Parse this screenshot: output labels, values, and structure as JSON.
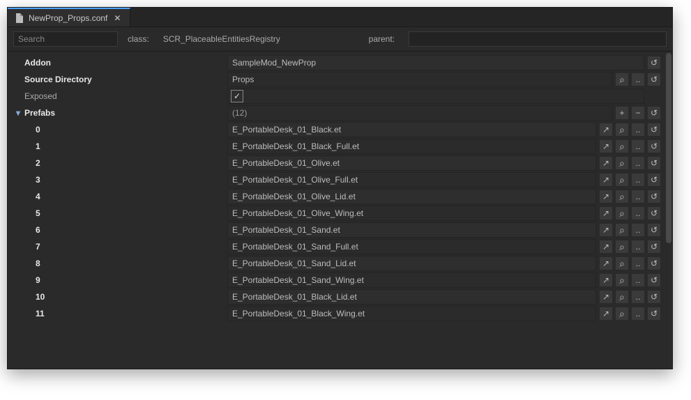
{
  "tab": {
    "title": "NewProp_Props.conf"
  },
  "toolbar": {
    "search_placeholder": "Search",
    "class_label": "class:",
    "class_value": "SCR_PlaceableEntitiesRegistry",
    "parent_label": "parent:"
  },
  "props": {
    "addon": {
      "label": "Addon",
      "value": "SampleMod_NewProp"
    },
    "source_dir": {
      "label": "Source Directory",
      "value": "Props"
    },
    "exposed": {
      "label": "Exposed",
      "checked": true
    },
    "prefabs": {
      "label": "Prefabs",
      "count_display": "(12)",
      "items": [
        {
          "index": "0",
          "value": "E_PortableDesk_01_Black.et"
        },
        {
          "index": "1",
          "value": "E_PortableDesk_01_Black_Full.et"
        },
        {
          "index": "2",
          "value": "E_PortableDesk_01_Olive.et"
        },
        {
          "index": "3",
          "value": "E_PortableDesk_01_Olive_Full.et"
        },
        {
          "index": "4",
          "value": "E_PortableDesk_01_Olive_Lid.et"
        },
        {
          "index": "5",
          "value": "E_PortableDesk_01_Olive_Wing.et"
        },
        {
          "index": "6",
          "value": "E_PortableDesk_01_Sand.et"
        },
        {
          "index": "7",
          "value": "E_PortableDesk_01_Sand_Full.et"
        },
        {
          "index": "8",
          "value": "E_PortableDesk_01_Sand_Lid.et"
        },
        {
          "index": "9",
          "value": "E_PortableDesk_01_Sand_Wing.et"
        },
        {
          "index": "10",
          "value": "E_PortableDesk_01_Black_Lid.et"
        },
        {
          "index": "11",
          "value": "E_PortableDesk_01_Black_Wing.et"
        }
      ]
    }
  },
  "icons": {
    "plus": "+",
    "minus": "−",
    "dots": "..",
    "reset": "↺",
    "open": "↗",
    "search": "⌕",
    "check": "✓",
    "close": "✕",
    "caret": "▾"
  }
}
